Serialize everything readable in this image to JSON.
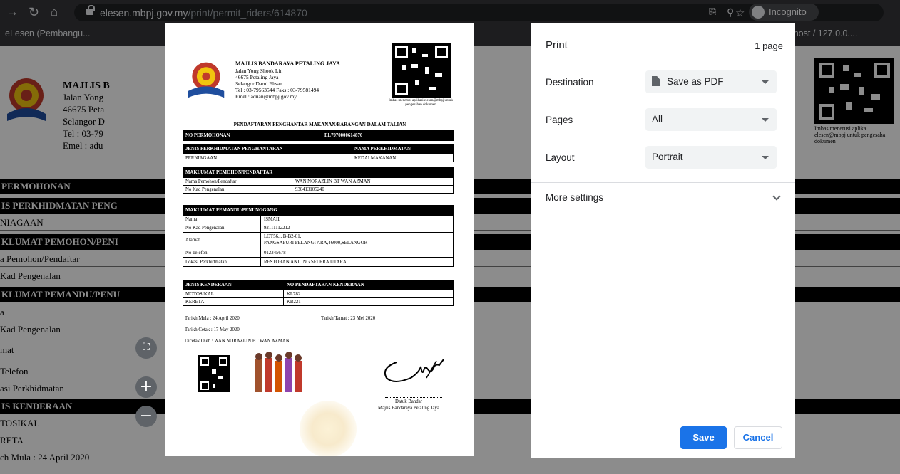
{
  "browser": {
    "url_domain": "elesen.mbpj.gov.my",
    "url_path": "/print/permit_riders/614870",
    "incognito_label": "Incognito",
    "tab_left": "eLesen (Pembangu...",
    "tab_right": "alhost / 127.0.0...."
  },
  "bg": {
    "title": "MAJLIS B",
    "addr": [
      "Jalan Yong",
      "46675 Peta",
      "Selangor D",
      "Tel : 03-79",
      "Emel : adu"
    ],
    "rows": [
      {
        "text": "PERMOHONAN",
        "bar": true
      },
      {
        "text": "IS PERKHIDMATAN PENG",
        "bar": true
      },
      {
        "text": "NIAGAAN",
        "bar": false
      },
      {
        "text": "KLUMAT PEMOHON/PENI",
        "bar": true
      },
      {
        "text": "a Pemohon/Pendaftar",
        "bar": false
      },
      {
        "text": "Kad Pengenalan",
        "bar": false
      },
      {
        "text": "KLUMAT PEMANDU/PENU",
        "bar": true
      },
      {
        "text": "a",
        "bar": false
      },
      {
        "text": "Kad Pengenalan",
        "bar": false
      },
      {
        "text": "mat",
        "bar": false
      },
      {
        "text": "Telefon",
        "bar": false
      },
      {
        "text": "asi Perkhidmatan",
        "bar": false
      },
      {
        "text": "IS KENDERAAN",
        "bar": true
      },
      {
        "text": "TOSIKAL",
        "bar": false
      },
      {
        "text": "RETA",
        "bar": false
      },
      {
        "text": "ch Mula : 24 April 2020",
        "bar": false
      }
    ],
    "right_note": "Imbas menerusi aplika elesen@mbpj untuk pengesaha dokumen"
  },
  "doc": {
    "council": "MAJLIS BANDARAYA PETALING JAYA",
    "address": [
      "Jalan Yong Shook Lin",
      "46675 Petaling Jaya",
      "Selangor Darul Ehsan",
      "Tel : 03-79563544 Faks : 03-79581494",
      "Emel : aduan@mbpj.gov.my"
    ],
    "qr_note": "Imbas menerusi aplikasi elesen@mbpj untuk pengesahan dokumen",
    "title": "PENDAFTARAN PENGHANTAR MAKANAN/BARANGAN DALAM TALIAN",
    "no_permohonan_label": "NO PERMOHONAN",
    "no_permohonan": "EL7970000614870",
    "jenis_label": "JENIS PERKHIDMATAN PENGHANTARAN",
    "nama_perkhidmatan_label": "NAMA PERKHIDMATAN",
    "jenis": "PERNIAGAAN",
    "nama_perkhidmatan": "KEDAI MAKANAN",
    "pemohon_header": "MAKLUMAT PEMOHON/PENDAFTAR",
    "pemohon_rows": [
      {
        "label": "Nama Pemohon/Pendaftar",
        "value": "WAN NORAZLIN BT WAN AZMAN"
      },
      {
        "label": "No Kad Pengenalan",
        "value": "930413105240"
      }
    ],
    "pemandu_header": "MAKLUMAT PEMANDU/PENUNGGANG",
    "pemandu_rows": [
      {
        "label": "Nama",
        "value": "ISMAIL",
        "value2": ""
      },
      {
        "label": "No Kad Pengenalan",
        "value": "92111112212",
        "value2": ""
      },
      {
        "label": "Alamat",
        "value": "LOT56, , B-B2-01,",
        "value2": "PANGSAPURI PELANGI ARA,46000,SELANGOR"
      },
      {
        "label": "No Telefon",
        "value": "012345678",
        "value2": ""
      },
      {
        "label": "Lokasi Perkhidmatan",
        "value": "RESTORAN ANJUNG SELERA UTARA",
        "value2": ""
      }
    ],
    "kenderaan_label": "JENIS KENDERAAN",
    "no_pendaftaran_label": "NO PENDAFTARAN KENDERAAN",
    "kenderaan_rows": [
      {
        "jenis": "MOTOSIKAL",
        "no": "KL782"
      },
      {
        "jenis": "KERETA",
        "no": "KB221"
      }
    ],
    "tarikh_mula": "Tarikh Mula : 24 April 2020",
    "tarikh_tamat": "Tarikh Tamat : 23 Mei 2020",
    "tarikh_cetak": "Tarikh Cetak : 17 May 2020",
    "dicetak_oleh": "Dicetak Oleh : WAN NORAZLIN BT WAN AZMAN",
    "sig_name": "Datuk Bandar",
    "sig_org": "Majlis Bandaraya Petaling Jaya"
  },
  "print": {
    "title": "Print",
    "pages_count": "1 page",
    "destination_label": "Destination",
    "destination_value": "Save as PDF",
    "pages_label": "Pages",
    "pages_value": "All",
    "layout_label": "Layout",
    "layout_value": "Portrait",
    "more_settings": "More settings",
    "save": "Save",
    "cancel": "Cancel"
  },
  "colors": {
    "accent": "#1a73e8",
    "chrome": "#35363a"
  }
}
